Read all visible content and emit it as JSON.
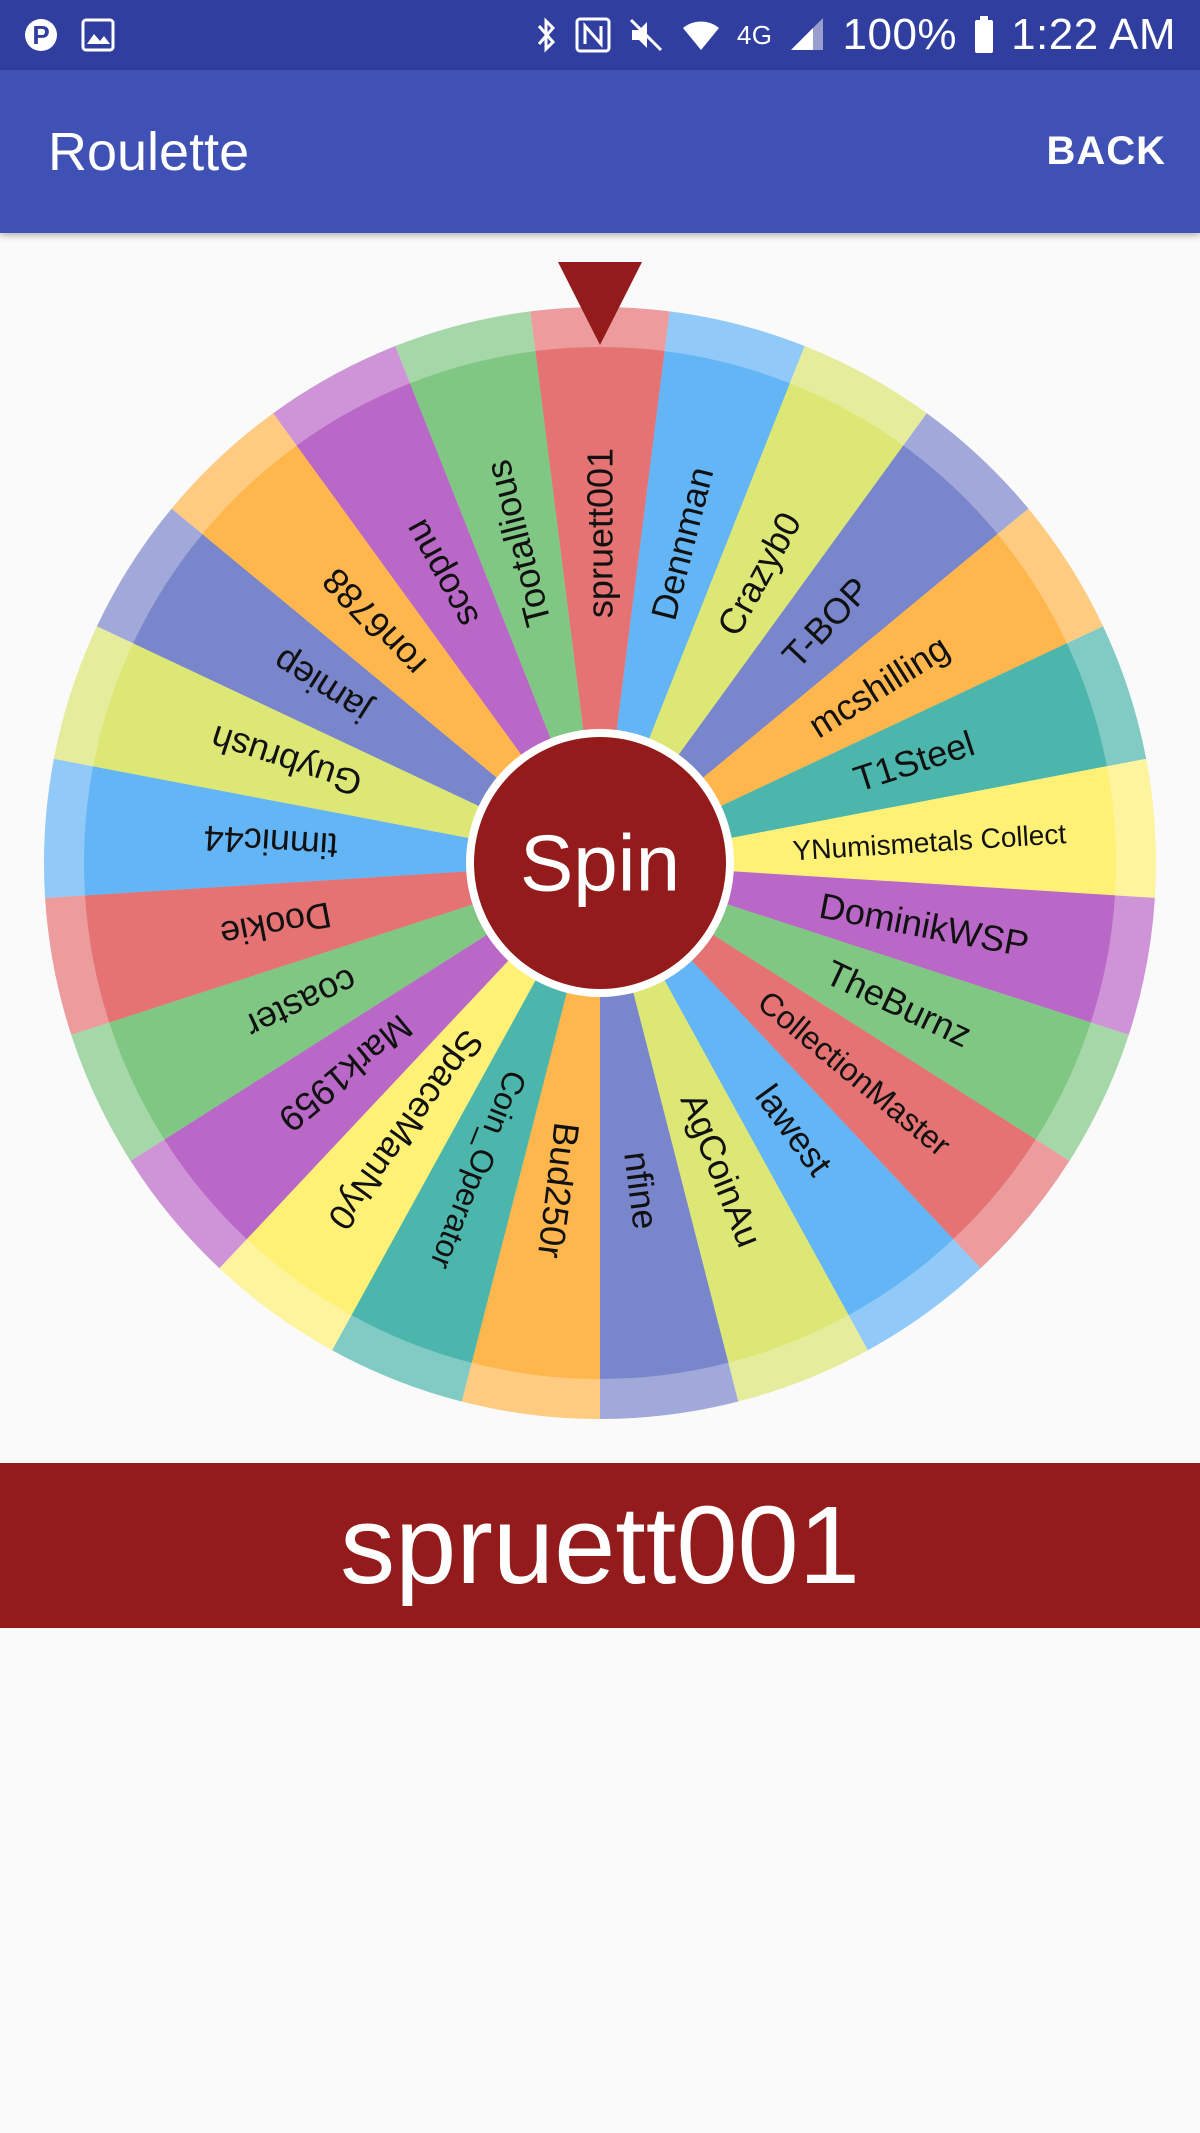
{
  "status_bar": {
    "battery": "100%",
    "time": "1:22 AM",
    "network": "4G",
    "icons": [
      "pinterest-icon",
      "image-icon",
      "bluetooth-icon",
      "nfc-icon",
      "mute-icon",
      "wifi-icon",
      "signal-icon",
      "battery-icon"
    ]
  },
  "app_bar": {
    "title": "Roulette",
    "back_label": "BACK"
  },
  "wheel": {
    "center_label": "Spin",
    "center_color": "#941b1b",
    "pointer_color": "#941b1b",
    "segments": [
      {
        "name": "spruett001",
        "color": "#e57373"
      },
      {
        "name": "Dennman",
        "color": "#64b5f6"
      },
      {
        "name": "Crazyb0",
        "color": "#dce775"
      },
      {
        "name": "T-BOP",
        "color": "#7986cb"
      },
      {
        "name": "mcshilling",
        "color": "#ffb74d"
      },
      {
        "name": "T1Steel",
        "color": "#4db6ac"
      },
      {
        "name": "YNumismetals Collect",
        "color": "#fff176"
      },
      {
        "name": "DominikWSP",
        "color": "#ba68c8"
      },
      {
        "name": "TheBurnz",
        "color": "#81c784"
      },
      {
        "name": "CollectionMaster",
        "color": "#e57373"
      },
      {
        "name": "lawest",
        "color": "#64b5f6"
      },
      {
        "name": "AgCoinAu",
        "color": "#dce775"
      },
      {
        "name": "nfine",
        "color": "#7986cb"
      },
      {
        "name": "Bud250r",
        "color": "#ffb74d"
      },
      {
        "name": "Coin_Operator",
        "color": "#4db6ac"
      },
      {
        "name": "SpaceManNy0",
        "color": "#fff176"
      },
      {
        "name": "Mark1959",
        "color": "#ba68c8"
      },
      {
        "name": "coaster",
        "color": "#81c784"
      },
      {
        "name": "Dookie",
        "color": "#e57373"
      },
      {
        "name": "timnic44",
        "color": "#64b5f6"
      },
      {
        "name": "Guybrush",
        "color": "#dce775"
      },
      {
        "name": "jamiep",
        "color": "#7986cb"
      },
      {
        "name": "ron6788",
        "color": "#ffb74d"
      },
      {
        "name": "scopnu",
        "color": "#ba68c8"
      },
      {
        "name": "Tootallious",
        "color": "#81c784"
      }
    ]
  },
  "result": {
    "winner": "spruett001",
    "color": "#941b1b"
  }
}
